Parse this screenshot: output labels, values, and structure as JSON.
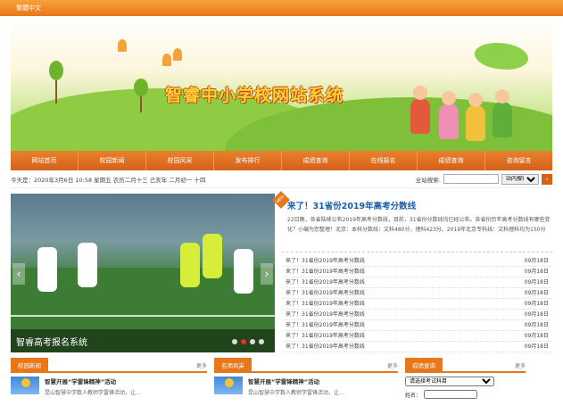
{
  "topbar": {
    "text": "繁體中文"
  },
  "banner": {
    "title": "智睿中小学校网站系统"
  },
  "nav": [
    "网站首页",
    "校园新闻",
    "校园风采",
    "发布排行",
    "成绩查询",
    "在线报名",
    "成绩查询",
    "咨询留言"
  ],
  "info": {
    "date": "今天是：2020年3月6日 10:58 星期五 农历二月十三 己亥年 二月初一 十四",
    "search_label": "全站搜索:",
    "search_placeholder": "",
    "search_select": "站内搜索",
    "search_button": "›"
  },
  "slider": {
    "caption": "智睿高考报名系统",
    "prev": "‹",
    "next": "›"
  },
  "news": {
    "hot_label": "NEW",
    "headline": "来了！31省份2019年高考分数线",
    "summary": "22日晚，各省陆续公布2019年高考分数线，目前，31省份分数线均已经公布。各省份历年高考分数线有哪些变化？小编为您整理！北京：本科分数线：文科480分，理科423分。2019年北京专科线：文科理科均为150分",
    "items": [
      {
        "title": "来了！31省份2019年高考分数线",
        "date": "09月18日"
      },
      {
        "title": "来了！31省份2019年高考分数线",
        "date": "09月18日"
      },
      {
        "title": "来了！31省份2019年高考分数线",
        "date": "09月18日"
      },
      {
        "title": "来了！31省份2019年高考分数线",
        "date": "09月18日"
      },
      {
        "title": "来了！31省份2019年高考分数线",
        "date": "09月18日"
      },
      {
        "title": "来了！31省份2019年高考分数线",
        "date": "09月18日"
      },
      {
        "title": "来了！31省份2019年高考分数线",
        "date": "09月18日"
      },
      {
        "title": "来了！31省份2019年高考分数线",
        "date": "09月18日"
      },
      {
        "title": "来了！31省份2019年高考分数线",
        "date": "09月18日"
      }
    ]
  },
  "sections": [
    {
      "tab": "校园新闻",
      "more": "更多",
      "title": "智慧开展“学雷锋精神”活动",
      "desc": "昆山智慧中学数人教师学雷锋活动，让…"
    },
    {
      "tab": "名师风采",
      "more": "更多",
      "title": "智慧开展“学雷锋精神”活动",
      "desc": "昆山智慧中学数人教师学雷锋活动，让…"
    },
    {
      "tab": "成绩查询",
      "more": "更多",
      "select": "请选择考试科目",
      "label": "姓名："
    }
  ],
  "colors": {
    "accent": "#e8771a",
    "headline": "#1b5ea8"
  }
}
